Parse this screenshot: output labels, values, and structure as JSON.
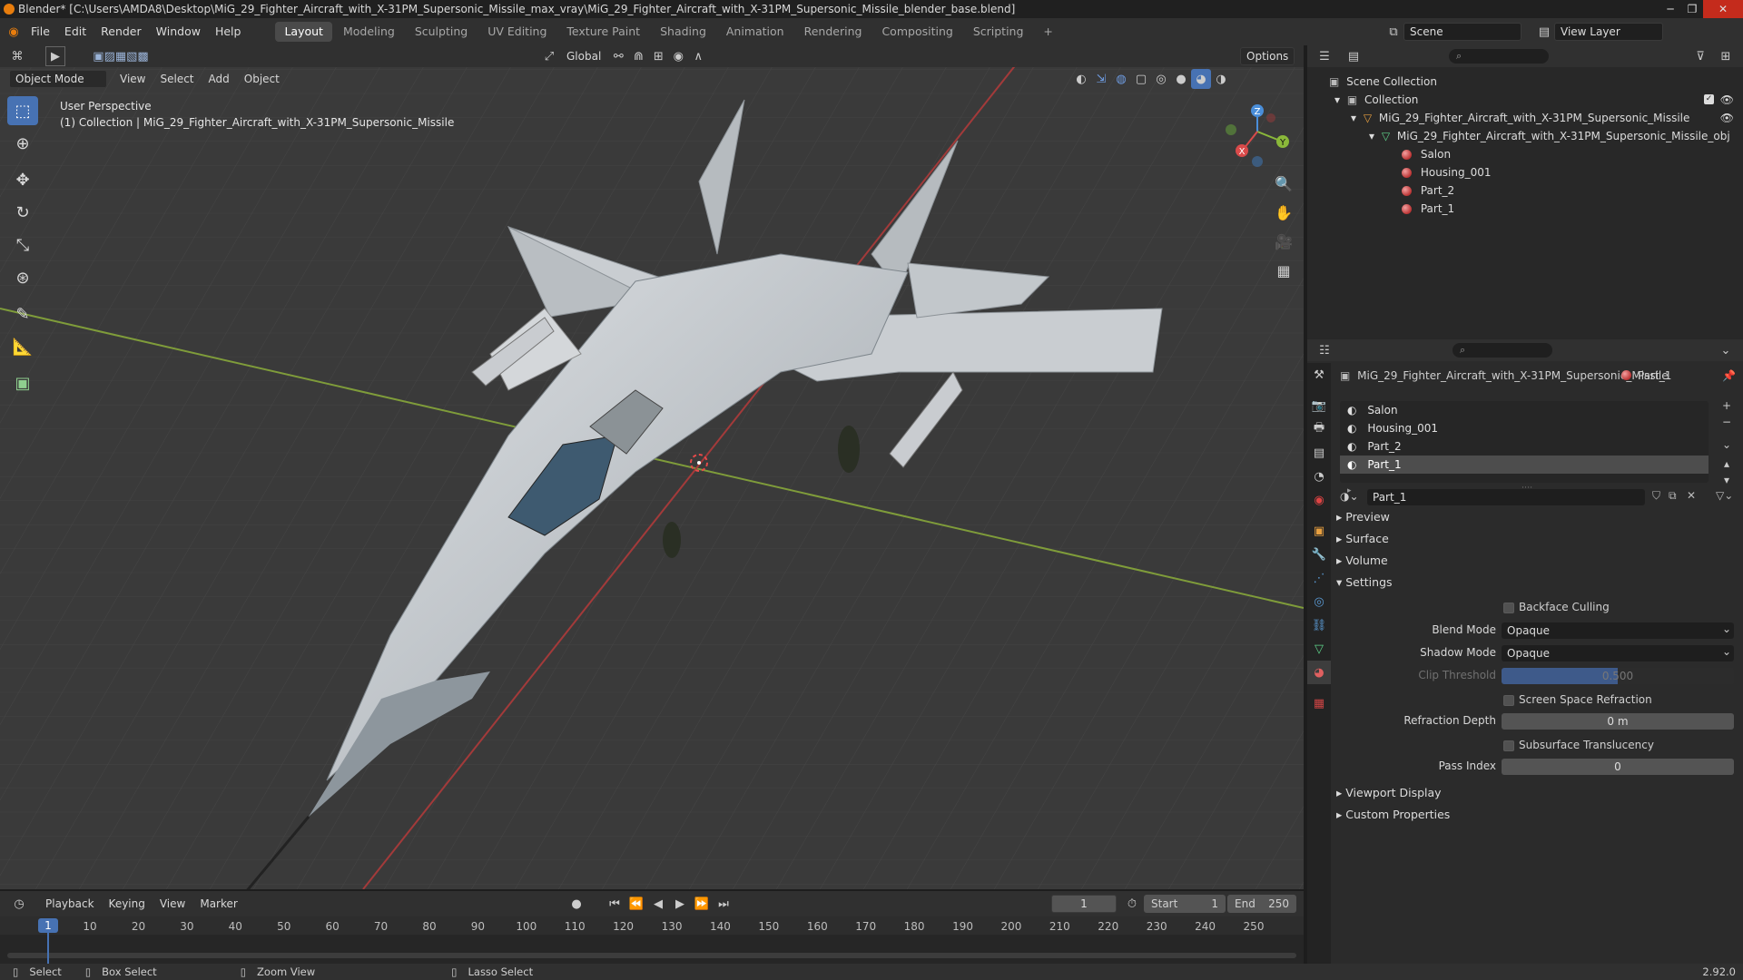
{
  "window": {
    "title": "Blender* [C:\\Users\\AMDA8\\Desktop\\MiG_29_Fighter_Aircraft_with_X-31PM_Supersonic_Missile_max_vray\\MiG_29_Fighter_Aircraft_with_X-31PM_Supersonic_Missile_blender_base.blend]",
    "controls": [
      "─",
      "❐",
      "✕"
    ]
  },
  "menubar": {
    "menus": [
      "File",
      "Edit",
      "Render",
      "Window",
      "Help"
    ],
    "workspaces": [
      "Layout",
      "Modeling",
      "Sculpting",
      "UV Editing",
      "Texture Paint",
      "Shading",
      "Animation",
      "Rendering",
      "Compositing",
      "Scripting"
    ],
    "active_workspace": "Layout",
    "add_tab": "+",
    "scene_label": "Scene",
    "view_layer_label": "View Layer"
  },
  "viewport": {
    "mode": "Object Mode",
    "menus": [
      "View",
      "Select",
      "Add",
      "Object"
    ],
    "orientation": "Global",
    "options_label": "Options",
    "perspective_label": "User Perspective",
    "collection_label": "(1) Collection | MiG_29_Fighter_Aircraft_with_X-31PM_Supersonic_Missile",
    "gizmo": {
      "x": "X",
      "y": "Y",
      "z": "Z"
    }
  },
  "outliner": {
    "root": "Scene Collection",
    "collection": "Collection",
    "object": "MiG_29_Fighter_Aircraft_with_X-31PM_Supersonic_Missile",
    "mesh": "MiG_29_Fighter_Aircraft_with_X-31PM_Supersonic_Missile_obj",
    "materials": [
      "Salon",
      "Housing_001",
      "Part_2",
      "Part_1"
    ]
  },
  "properties": {
    "object_name": "MiG_29_Fighter_Aircraft_with_X-31PM_Supersonic_Missile",
    "material_name": "Part_1",
    "slots": [
      "Salon",
      "Housing_001",
      "Part_2",
      "Part_1"
    ],
    "selected_slot": "Part_1",
    "material_field": "Part_1",
    "sections": {
      "preview": "Preview",
      "surface": "Surface",
      "volume": "Volume",
      "settings": "Settings",
      "viewport_display": "Viewport Display",
      "custom_properties": "Custom Properties"
    },
    "settings": {
      "backface_culling": "Backface Culling",
      "blend_mode_label": "Blend Mode",
      "blend_mode": "Opaque",
      "shadow_mode_label": "Shadow Mode",
      "shadow_mode": "Opaque",
      "clip_threshold_label": "Clip Threshold",
      "clip_threshold": "0.500",
      "screen_space_refraction": "Screen Space Refraction",
      "refraction_depth_label": "Refraction Depth",
      "refraction_depth": "0 m",
      "subsurface_translucency": "Subsurface Translucency",
      "pass_index_label": "Pass Index",
      "pass_index": "0"
    }
  },
  "timeline": {
    "menus": [
      "Playback",
      "Keying",
      "View",
      "Marker"
    ],
    "current_frame": "1",
    "start_label": "Start",
    "start": "1",
    "end_label": "End",
    "end": "250",
    "ticks": [
      "10",
      "20",
      "30",
      "40",
      "50",
      "60",
      "70",
      "80",
      "90",
      "100",
      "110",
      "120",
      "130",
      "140",
      "150",
      "160",
      "170",
      "180",
      "190",
      "200",
      "210",
      "220",
      "230",
      "240",
      "250"
    ],
    "playhead": "1"
  },
  "statusbar": {
    "select": "Select",
    "box_select": "Box Select",
    "zoom_view": "Zoom View",
    "lasso_select": "Lasso Select",
    "version": "2.92.0"
  },
  "colors": {
    "accent": "#4772b3",
    "x_axis": "#d94a4a",
    "y_axis": "#8ab83a",
    "z_axis": "#4a8ed9",
    "material": "#c84040"
  }
}
